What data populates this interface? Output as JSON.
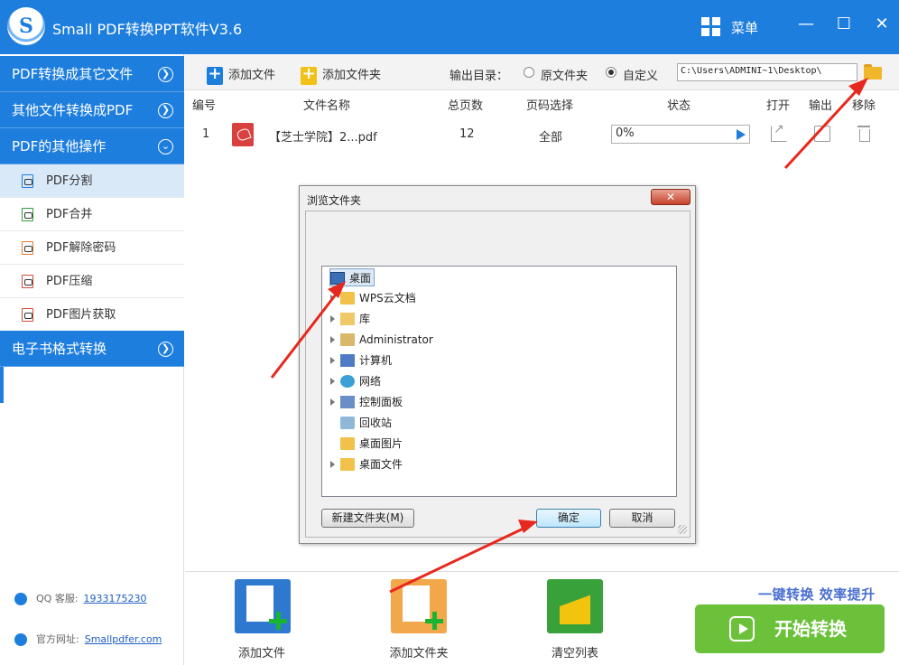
{
  "app": {
    "logo_letter": "S",
    "title": "Small PDF转换PPT软件V3.6",
    "menu_label": "菜单",
    "minimize": "—",
    "maximize": "☐",
    "close": "✕"
  },
  "sidebar": {
    "categories": [
      {
        "label": "PDF转换成其它文件",
        "arrow": "❯"
      },
      {
        "label": "其他文件转换成PDF",
        "arrow": "❯"
      },
      {
        "label": "PDF的其他操作",
        "arrow": "⌄"
      },
      {
        "label": "电子书格式转换",
        "arrow": "❯"
      }
    ],
    "items": [
      {
        "label": "PDF分割",
        "active": true
      },
      {
        "label": "PDF合并",
        "active": false
      },
      {
        "label": "PDF解除密码",
        "active": false
      },
      {
        "label": "PDF压缩",
        "active": false
      },
      {
        "label": "PDF图片获取",
        "active": false
      }
    ],
    "qq_label": "QQ 客服:",
    "qq_value": "1933175230",
    "site_label": "官方网址:",
    "site_value": "Smallpdfer.com"
  },
  "toolbar": {
    "add_file": "添加文件",
    "add_folder": "添加文件夹",
    "output_label": "输出目录：",
    "radio_original": "原文件夹",
    "radio_custom": "自定义",
    "path": "C:\\Users\\ADMINI~1\\Desktop\\"
  },
  "table": {
    "headers": [
      "编号",
      "文件名称",
      "总页数",
      "页码选择",
      "状态",
      "打开",
      "输出",
      "移除"
    ],
    "rows": [
      {
        "index": "1",
        "name": "【芝士学院】2...pdf",
        "pages": "12",
        "range": "全部",
        "status": "0%"
      }
    ]
  },
  "dialog": {
    "title": "浏览文件夹",
    "close": "✕",
    "tree": [
      {
        "label": "桌面",
        "selected": true,
        "expandable": false,
        "icon": "desktop-icon"
      },
      {
        "label": "WPS云文档",
        "selected": false,
        "expandable": true,
        "icon": "cloud-folder-icon"
      },
      {
        "label": "库",
        "selected": false,
        "expandable": true,
        "icon": "library-icon"
      },
      {
        "label": "Administrator",
        "selected": false,
        "expandable": true,
        "icon": "user-folder-icon"
      },
      {
        "label": "计算机",
        "selected": false,
        "expandable": true,
        "icon": "computer-icon"
      },
      {
        "label": "网络",
        "selected": false,
        "expandable": true,
        "icon": "network-icon"
      },
      {
        "label": "控制面板",
        "selected": false,
        "expandable": true,
        "icon": "control-panel-icon"
      },
      {
        "label": "回收站",
        "selected": false,
        "expandable": false,
        "icon": "recycle-bin-icon"
      },
      {
        "label": "桌面图片",
        "selected": false,
        "expandable": false,
        "icon": "folder-icon"
      },
      {
        "label": "桌面文件",
        "selected": false,
        "expandable": true,
        "icon": "folder-icon"
      }
    ],
    "new_folder": "新建文件夹(M)",
    "ok": "确定",
    "cancel": "取消"
  },
  "bottom": {
    "add_file": "添加文件",
    "add_folder": "添加文件夹",
    "clear_list": "清空列表",
    "slogan": "一键转换  效率提升",
    "start": "开始转换"
  },
  "colors": {
    "brand_blue": "#1e7ede",
    "start_green": "#6cc13a",
    "annotation_red": "#e8281e"
  }
}
